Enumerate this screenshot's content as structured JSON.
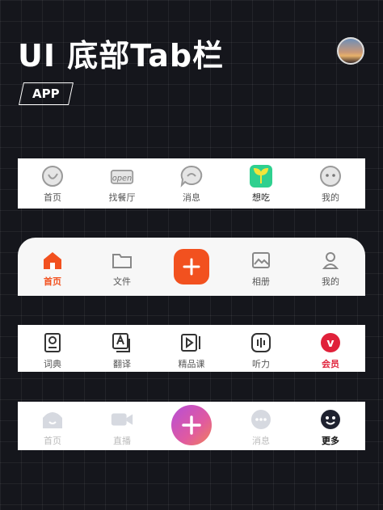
{
  "header": {
    "title": "UI 底部Tab栏",
    "tag": "APP"
  },
  "bar1": {
    "items": [
      "首页",
      "找餐厅",
      "消息",
      "想吃",
      "我的"
    ],
    "badge_text": "open"
  },
  "bar2": {
    "items": [
      "首页",
      "文件",
      "相册",
      "我的"
    ],
    "active_color": "#f2511f"
  },
  "bar3": {
    "items": [
      "词典",
      "翻译",
      "精品课",
      "听力",
      "会员"
    ],
    "member_color": "#e0213a",
    "member_badge": "v"
  },
  "bar4": {
    "items": [
      "首页",
      "直播",
      "消息",
      "更多"
    ]
  }
}
